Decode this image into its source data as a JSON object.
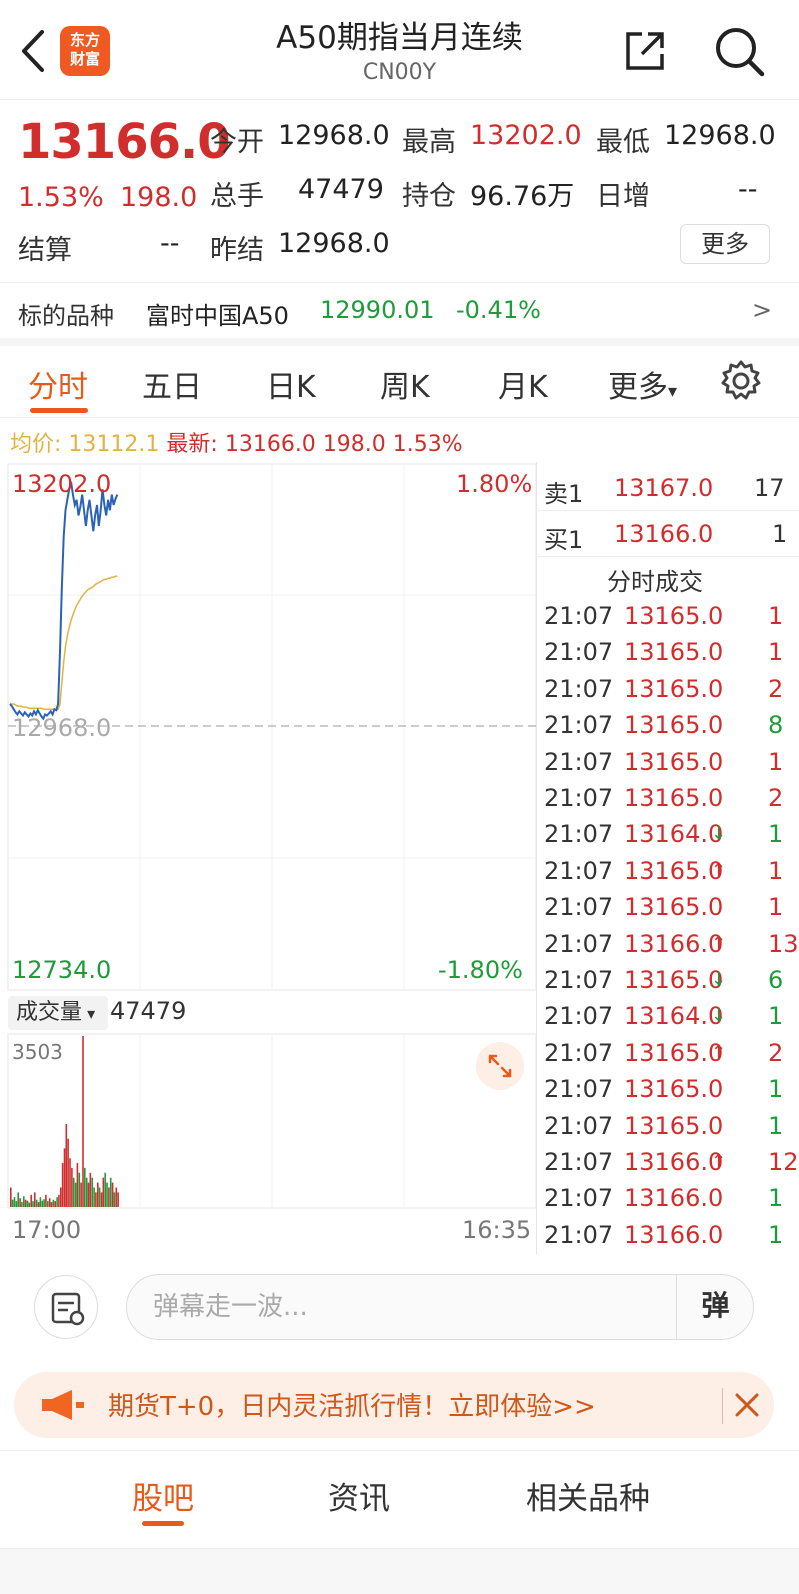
{
  "header": {
    "title": "A50期指当月连续",
    "subtitle": "CN00Y",
    "logo_line1": "东方",
    "logo_line2": "财富"
  },
  "quote": {
    "price": "13166.0",
    "change_pct": "1.53%",
    "change": "198.0",
    "open_label": "今开",
    "open": "12968.0",
    "high_label": "最高",
    "high": "13202.0",
    "low_label": "最低",
    "low": "12968.0",
    "volume_label": "总手",
    "volume": "47479",
    "oi_label": "持仓",
    "oi": "96.76万",
    "daily_inc_label": "日增",
    "daily_inc": "--",
    "settle_label": "结算",
    "settle": "--",
    "prev_settle_label": "昨结",
    "prev_settle": "12968.0",
    "more_label": "更多"
  },
  "underlying": {
    "label": "标的品种",
    "name": "富时中国A50",
    "price": "12990.01",
    "change_pct": "-0.41%",
    "arrow": ">"
  },
  "tabs": [
    "分时",
    "五日",
    "日K",
    "周K",
    "月K",
    "更多"
  ],
  "avg_bar": {
    "avg_label": "均价:",
    "avg": "13112.1",
    "latest_label": "最新:",
    "latest": "13166.0",
    "change": "198.0",
    "change_pct": "1.53%"
  },
  "chart": {
    "y_top": "13202.0",
    "y_mid": "12968.0",
    "y_bottom": "12734.0",
    "pct_top": "1.80%",
    "pct_bottom": "-1.80%",
    "vol_max": "3503",
    "time_start": "17:00",
    "time_end": "16:35",
    "vol_label": "成交量",
    "vol_value": "47479"
  },
  "chart_data": {
    "type": "line",
    "ylim": [
      12734.0,
      13202.0
    ],
    "price": [
      12990,
      12988,
      12985,
      12982,
      12980,
      12983,
      12981,
      12979,
      12982,
      12980,
      12978,
      12981,
      12979,
      12983,
      12980,
      12984,
      12981,
      12978,
      12976,
      12980,
      12979,
      12981,
      12983,
      12980,
      12985,
      12984,
      12990,
      13040,
      13100,
      13150,
      13175,
      13185,
      13195,
      13202,
      13190,
      13180,
      13185,
      13170,
      13178,
      13190,
      13175,
      13160,
      13175,
      13185,
      13170,
      13155,
      13170,
      13180,
      13160,
      13175,
      13195,
      13180,
      13170,
      13185,
      13175,
      13190,
      13180,
      13186,
      13190
    ],
    "avg": [
      12990,
      12990,
      12990,
      12989,
      12988,
      12988,
      12988,
      12987,
      12987,
      12987,
      12986,
      12986,
      12986,
      12986,
      12986,
      12986,
      12986,
      12986,
      12985,
      12985,
      12985,
      12985,
      12985,
      12985,
      12985,
      12985,
      12985,
      12990,
      13010,
      13030,
      13045,
      13055,
      13063,
      13070,
      13075,
      13080,
      13084,
      13087,
      13090,
      13093,
      13095,
      13097,
      13099,
      13100,
      13101,
      13102,
      13104,
      13105,
      13106,
      13107,
      13108,
      13109,
      13109,
      13110,
      13110,
      13111,
      13111,
      13112,
      13112
    ],
    "volume": [
      400,
      150,
      200,
      120,
      300,
      180,
      100,
      220,
      150,
      130,
      90,
      250,
      120,
      300,
      150,
      100,
      200,
      130,
      160,
      250,
      120,
      180,
      100,
      150,
      120,
      200,
      250,
      400,
      900,
      1200,
      1700,
      1400,
      1000,
      800,
      600,
      500,
      900,
      700,
      500,
      3503,
      800,
      600,
      500,
      700,
      600,
      400,
      300,
      500,
      400,
      300,
      600,
      700,
      500,
      400,
      600,
      500,
      300,
      400,
      300
    ]
  },
  "orderbook": {
    "sell1_label": "卖1",
    "sell1_price": "13167.0",
    "sell1_qty": "17",
    "buy1_label": "买1",
    "buy1_price": "13166.0",
    "buy1_qty": "1",
    "trade_title": "分时成交"
  },
  "trades": [
    {
      "time": "21:07",
      "price": "13165.0",
      "arrow": "",
      "qty": "1",
      "qty_color": "red"
    },
    {
      "time": "21:07",
      "price": "13165.0",
      "arrow": "",
      "qty": "1",
      "qty_color": "red"
    },
    {
      "time": "21:07",
      "price": "13165.0",
      "arrow": "",
      "qty": "2",
      "qty_color": "red"
    },
    {
      "time": "21:07",
      "price": "13165.0",
      "arrow": "",
      "qty": "8",
      "qty_color": "green"
    },
    {
      "time": "21:07",
      "price": "13165.0",
      "arrow": "",
      "qty": "1",
      "qty_color": "red"
    },
    {
      "time": "21:07",
      "price": "13165.0",
      "arrow": "",
      "qty": "2",
      "qty_color": "red"
    },
    {
      "time": "21:07",
      "price": "13164.0",
      "arrow": "↓",
      "qty": "1",
      "qty_color": "green"
    },
    {
      "time": "21:07",
      "price": "13165.0",
      "arrow": "↑",
      "qty": "1",
      "qty_color": "red"
    },
    {
      "time": "21:07",
      "price": "13165.0",
      "arrow": "",
      "qty": "1",
      "qty_color": "red"
    },
    {
      "time": "21:07",
      "price": "13166.0",
      "arrow": "↑",
      "qty": "13",
      "qty_color": "red"
    },
    {
      "time": "21:07",
      "price": "13165.0",
      "arrow": "↓",
      "qty": "6",
      "qty_color": "green"
    },
    {
      "time": "21:07",
      "price": "13164.0",
      "arrow": "↓",
      "qty": "1",
      "qty_color": "green"
    },
    {
      "time": "21:07",
      "price": "13165.0",
      "arrow": "↑",
      "qty": "2",
      "qty_color": "red"
    },
    {
      "time": "21:07",
      "price": "13165.0",
      "arrow": "",
      "qty": "1",
      "qty_color": "green"
    },
    {
      "time": "21:07",
      "price": "13165.0",
      "arrow": "",
      "qty": "1",
      "qty_color": "green"
    },
    {
      "time": "21:07",
      "price": "13166.0",
      "arrow": "↑",
      "qty": "12",
      "qty_color": "red"
    },
    {
      "time": "21:07",
      "price": "13166.0",
      "arrow": "",
      "qty": "1",
      "qty_color": "green"
    },
    {
      "time": "21:07",
      "price": "13166.0",
      "arrow": "",
      "qty": "1",
      "qty_color": "green"
    }
  ],
  "danmu": {
    "placeholder": "弹幕走一波...",
    "send": "弹"
  },
  "promo": {
    "text": "期货T+0，日内灵活抓行情！立即体验>>"
  },
  "bottom_tabs": [
    "股吧",
    "资讯",
    "相关品种"
  ],
  "colors": {
    "up": "#d22d2d",
    "down": "#1e9b3a",
    "accent": "#e85a1a",
    "price_line": "#2a62b8",
    "avg_line": "#e3b341"
  }
}
